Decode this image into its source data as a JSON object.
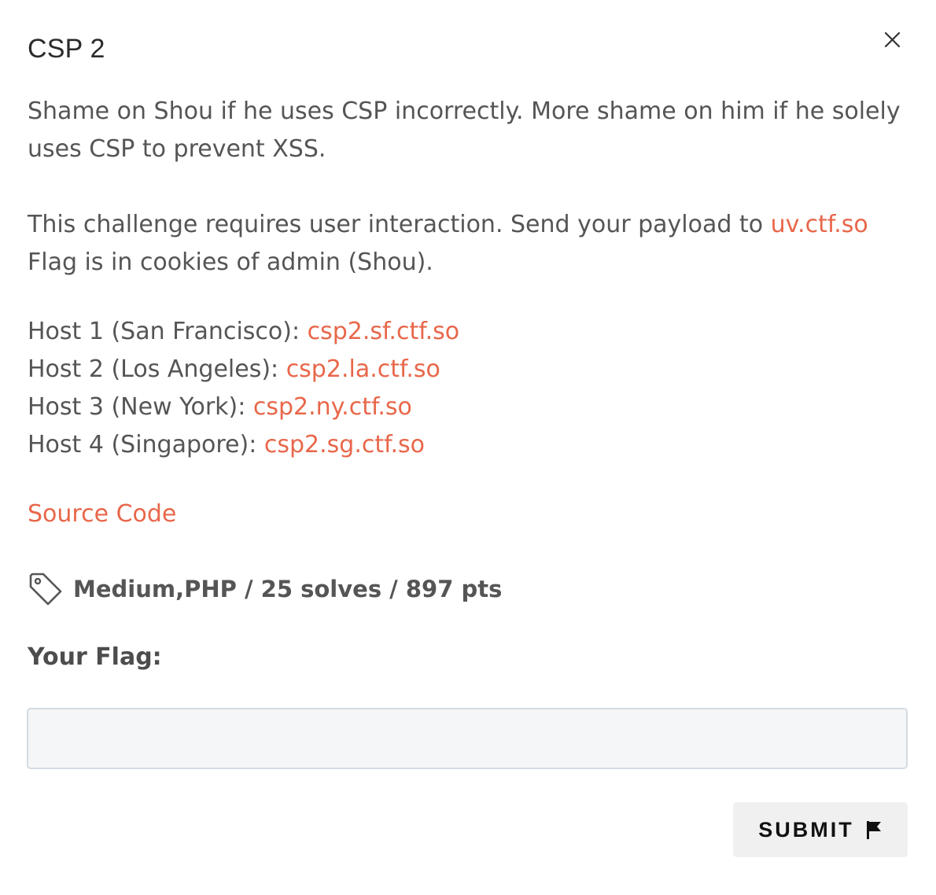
{
  "modal": {
    "title": "CSP 2",
    "close_icon": "close-icon"
  },
  "description": {
    "line1": "Shame on Shou if he uses CSP incorrectly. More shame on him if he solely uses CSP to prevent XSS.",
    "interaction_prefix": "This challenge requires user interaction. Send your payload to ",
    "interaction_link": "uv.ctf.so",
    "flag_location": "Flag is in cookies of admin (Shou).",
    "hosts": [
      {
        "label": "Host 1 (San Francisco): ",
        "link": "csp2.sf.ctf.so"
      },
      {
        "label": "Host 2 (Los Angeles): ",
        "link": "csp2.la.ctf.so"
      },
      {
        "label": "Host 3 (New York): ",
        "link": "csp2.ny.ctf.so"
      },
      {
        "label": "Host 4 (Singapore): ",
        "link": "csp2.sg.ctf.so"
      }
    ]
  },
  "source_link": "Source Code",
  "meta": {
    "tag_icon": "tag-icon",
    "text": "Medium,PHP / 25 solves / 897 pts"
  },
  "flag_form": {
    "label": "Your Flag:",
    "input_value": "",
    "input_placeholder": "",
    "submit_label": "SUBMIT",
    "submit_icon": "flag-icon"
  },
  "colors": {
    "link": "#e8674a",
    "text": "#555555",
    "title": "#2b2b2b",
    "input_bg": "#f5f6f7",
    "input_border": "#d4dbe2",
    "button_bg": "#f0f0f0"
  }
}
